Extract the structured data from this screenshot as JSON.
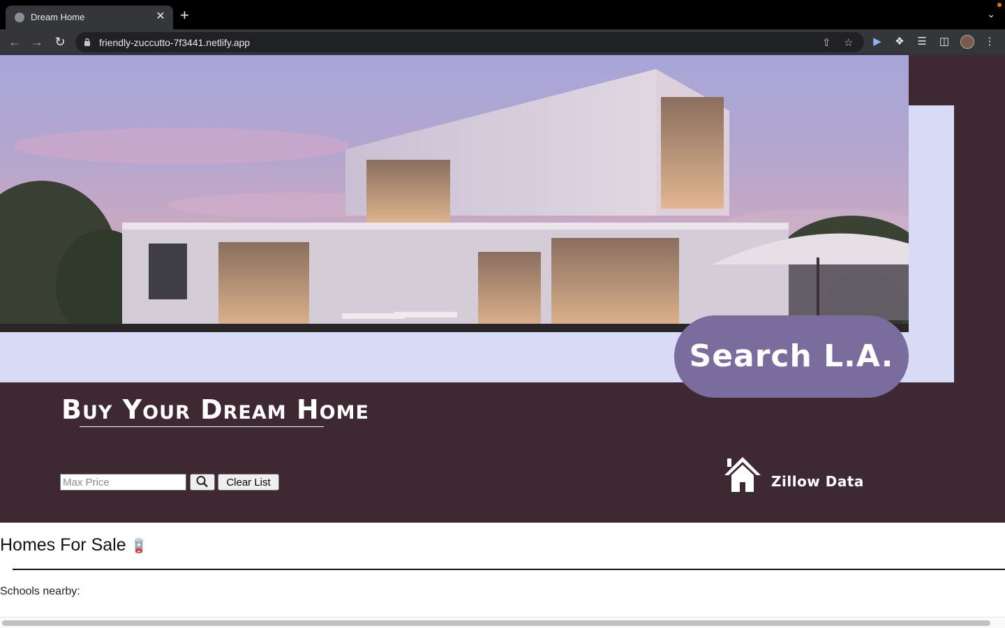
{
  "browser": {
    "tab_title": "Dream Home",
    "tab_close": "✕",
    "new_tab": "+",
    "url": "friendly-zuccutto-7f3441.netlify.app"
  },
  "hero": {
    "search_pill": "Search L.A.",
    "headline": "Buy Your Dream Home"
  },
  "controls": {
    "max_price_placeholder": "Max Price",
    "max_price_value": "",
    "clear_label": "Clear List"
  },
  "brand": {
    "zillow_label": "Zillow Data"
  },
  "listings": {
    "title": "Homes For Sale",
    "schools_label": "Schools nearby:"
  },
  "colors": {
    "maroon": "#3e2832",
    "lavender": "#d8dbf5",
    "pill": "#7a6c9c"
  }
}
